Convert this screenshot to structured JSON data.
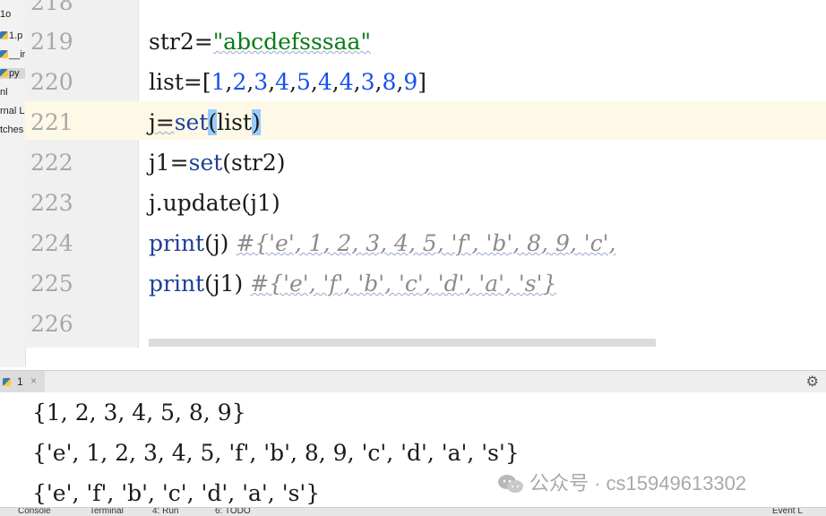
{
  "project_tree": {
    "items": [
      {
        "label": "1o"
      },
      {
        "label": "1.p"
      },
      {
        "label": "__ir"
      },
      {
        "label": "py"
      },
      {
        "label": "nl"
      },
      {
        "label": "rnal L"
      },
      {
        "label": "tches"
      }
    ]
  },
  "editor": {
    "lines": [
      {
        "number": "218"
      },
      {
        "number": "219",
        "code": {
          "a": "str2=",
          "b": "\"abcdefsssaa\""
        }
      },
      {
        "number": "220",
        "code": {
          "a": "list=[",
          "n1": "1",
          "n2": "2",
          "n3": "3",
          "n4": "4",
          "n5": "5",
          "n6": "4",
          "n7": "4",
          "n8": "3",
          "n9": "8",
          "n10": "9",
          "z": "]"
        }
      },
      {
        "number": "221",
        "code": {
          "a": "j=",
          "kw": "set",
          "p1": "(",
          "b": "list",
          "p2": ")"
        }
      },
      {
        "number": "222",
        "code": {
          "a": "j1=",
          "kw": "set",
          "b": "(str2)"
        }
      },
      {
        "number": "223",
        "code": {
          "a": "j.update(j1)"
        }
      },
      {
        "number": "224",
        "code": {
          "kw": "print",
          "b": "(j) ",
          "cmt": "#{'e', 1, 2, 3, 4, 5, 'f', 'b', 8, 9, 'c',"
        }
      },
      {
        "number": "225",
        "code": {
          "kw": "print",
          "b": "(j1) ",
          "cmt": "#{'e', 'f', 'b', 'c', 'd', 'a', 's'}"
        }
      },
      {
        "number": "226"
      }
    ]
  },
  "run_panel": {
    "tab_label": "1",
    "close": "×",
    "output": [
      "{1, 2, 3, 4, 5, 8, 9}",
      "{'e', 1, 2, 3, 4, 5, 'f', 'b', 8, 9, 'c', 'd', 'a', 's'}",
      "{'e', 'f', 'b', 'c', 'd', 'a', 's'}"
    ]
  },
  "watermark": {
    "text": "公众号 · cs15949613302"
  },
  "bottom_bar": {
    "items": [
      "Console",
      "Terminal",
      "4: Run",
      "6: TODO",
      "Event L"
    ]
  },
  "colors": {
    "string": "#067d17",
    "number": "#1750eb",
    "keyword": "#1f3f99",
    "comment": "#8c8c8c",
    "current_line": "#fdf9e6",
    "brace_highlight": "#99ccff"
  }
}
